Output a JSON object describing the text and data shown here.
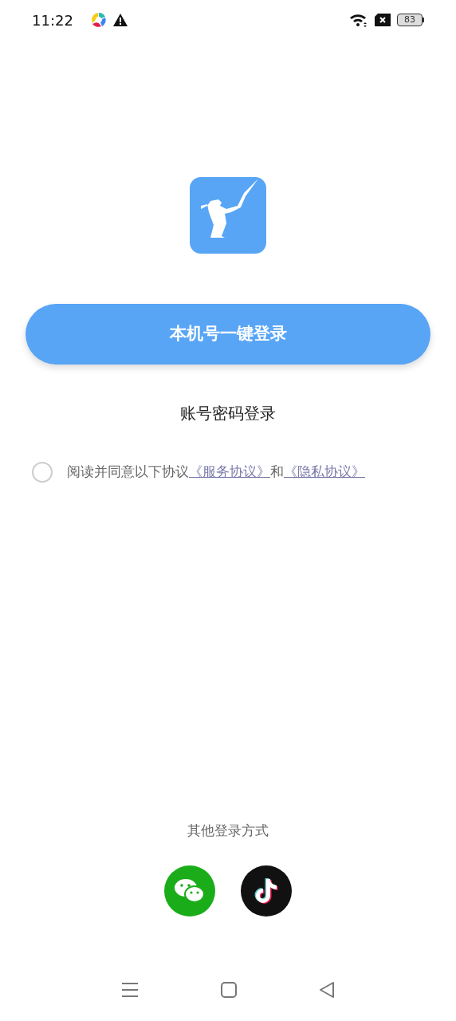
{
  "status_bar": {
    "time": "11:22",
    "battery": "83"
  },
  "login_button": {
    "label": "本机号一键登录"
  },
  "password_login": {
    "label": "账号密码登录"
  },
  "agreement": {
    "checked": false,
    "text": "阅读并同意以下协议",
    "link_1": "《服务协议》",
    "connector": "和",
    "link_2": "《隐私协议》"
  },
  "other_login": {
    "title": "其他登录方式"
  }
}
